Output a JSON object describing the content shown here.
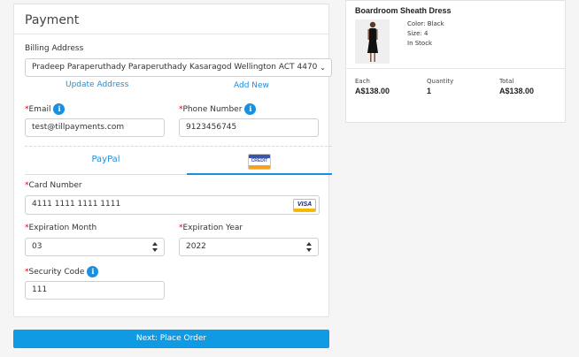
{
  "payment": {
    "title": "Payment",
    "billing_label": "Billing Address",
    "billing_value": "Pradeep Paraperuthady Paraperuthady Kasaragod Wellington ACT 4470",
    "update_address": "Update Address",
    "add_new": "Add New",
    "email_label": "Email",
    "email_value": "test@tillpayments.com",
    "phone_label": "Phone Number",
    "phone_value": "9123456745",
    "tab_paypal": "PayPal",
    "tab_credit_text": "CREDIT",
    "card_number_label": "Card Number",
    "card_number_value": "4111 1111 1111 1111",
    "card_brand": "VISA",
    "exp_month_label": "Expiration Month",
    "exp_month_value": "03",
    "exp_year_label": "Expiration Year",
    "exp_year_value": "2022",
    "security_label": "Security Code",
    "security_value": "111",
    "required_mark": "*",
    "info_glyph": "i"
  },
  "next_button": "Next: Place Order",
  "order": {
    "product_name": "Boardroom Sheath Dress",
    "color": "Color: Black",
    "size": "Size: 4",
    "stock": "In Stock",
    "each_label": "Each",
    "each_value": "A$138.00",
    "qty_label": "Quantity",
    "qty_value": "1",
    "total_label": "Total",
    "total_value": "A$138.00"
  },
  "colors": {
    "accent": "#1a8fe0",
    "button": "#0f9ae3",
    "required": "#d0021b"
  }
}
